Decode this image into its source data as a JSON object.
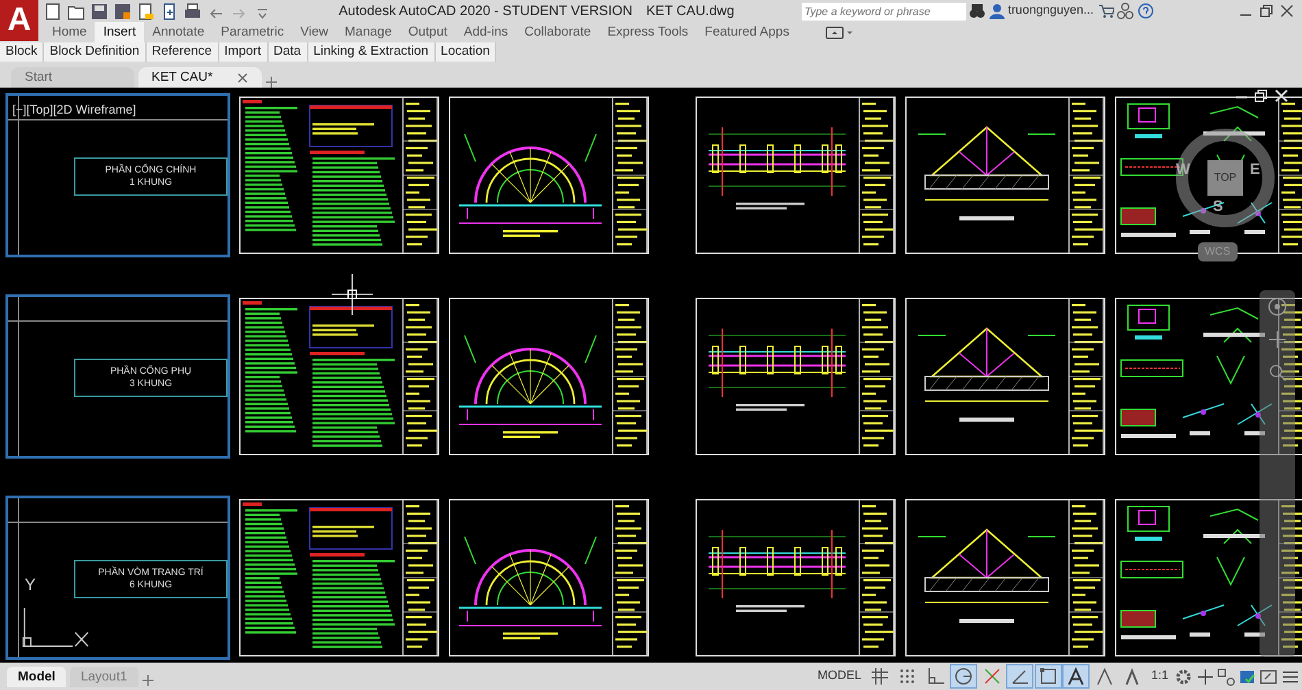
{
  "app_button": {
    "label": "A"
  },
  "window": {
    "title": "Autodesk AutoCAD 2020 - STUDENT VERSION",
    "file_name": "KET CAU.dwg"
  },
  "search": {
    "placeholder": "Type a keyword or phrase"
  },
  "user": {
    "name": "truongnguyen..."
  },
  "ribbon_tabs": [
    {
      "label": "Home",
      "selected": false
    },
    {
      "label": "Insert",
      "selected": true
    },
    {
      "label": "Annotate",
      "selected": false
    },
    {
      "label": "Parametric",
      "selected": false
    },
    {
      "label": "View",
      "selected": false
    },
    {
      "label": "Manage",
      "selected": false
    },
    {
      "label": "Output",
      "selected": false
    },
    {
      "label": "Add-ins",
      "selected": false
    },
    {
      "label": "Collaborate",
      "selected": false
    },
    {
      "label": "Express Tools",
      "selected": false
    },
    {
      "label": "Featured Apps",
      "selected": false
    }
  ],
  "ribbon_panels": [
    "Block",
    "Block Definition",
    "Reference",
    "Import",
    "Data",
    "Linking & Extraction",
    "Location"
  ],
  "file_tabs": [
    {
      "label": "Start",
      "selected": false
    },
    {
      "label": "KET CAU*",
      "selected": true
    }
  ],
  "viewport": {
    "label": "[−][Top][2D Wireframe]",
    "sheet_rows": [
      {
        "cover_lines": [
          "PHẦN CỔNG CHÍNH",
          "1 KHUNG"
        ],
        "sheets": [
          {
            "kind": "notes"
          },
          {
            "kind": "arch"
          },
          {
            "kind": "plan"
          },
          {
            "kind": "truss"
          },
          {
            "kind": "details"
          }
        ]
      },
      {
        "cover_lines": [
          "PHẦN CỔNG PHỤ",
          "3 KHUNG"
        ],
        "sheets": [
          {
            "kind": "notes"
          },
          {
            "kind": "arch"
          },
          {
            "kind": "plan"
          },
          {
            "kind": "truss"
          },
          {
            "kind": "details"
          }
        ]
      },
      {
        "cover_lines": [
          "PHẦN VÒM TRANG TRÍ",
          "6 KHUNG"
        ],
        "ucs_axis": "Y",
        "sheets": [
          {
            "kind": "notes"
          },
          {
            "kind": "arch"
          },
          {
            "kind": "plan"
          },
          {
            "kind": "truss"
          },
          {
            "kind": "details"
          }
        ]
      }
    ]
  },
  "viewcube": {
    "face": "TOP",
    "west": "W",
    "east": "E",
    "south": "S",
    "ucs_menu": "WCS"
  },
  "layout_tabs": [
    {
      "label": "Model",
      "selected": true
    },
    {
      "label": "Layout1",
      "selected": false
    }
  ],
  "status_bar": {
    "mode": "MODEL",
    "scale": "1:1",
    "toggles": [
      {
        "kind": "grid",
        "on": false
      },
      {
        "kind": "snap",
        "on": false
      },
      {
        "kind": "ortho",
        "on": false
      },
      {
        "kind": "polar",
        "on": true
      },
      {
        "kind": "isodraft",
        "on": false
      },
      {
        "kind": "tracking",
        "on": true
      },
      {
        "kind": "osnap",
        "on": true
      },
      {
        "kind": "annovisible",
        "on": true
      },
      {
        "kind": "autoscale",
        "on": false
      },
      {
        "kind": "annoscale",
        "on": false
      }
    ]
  }
}
